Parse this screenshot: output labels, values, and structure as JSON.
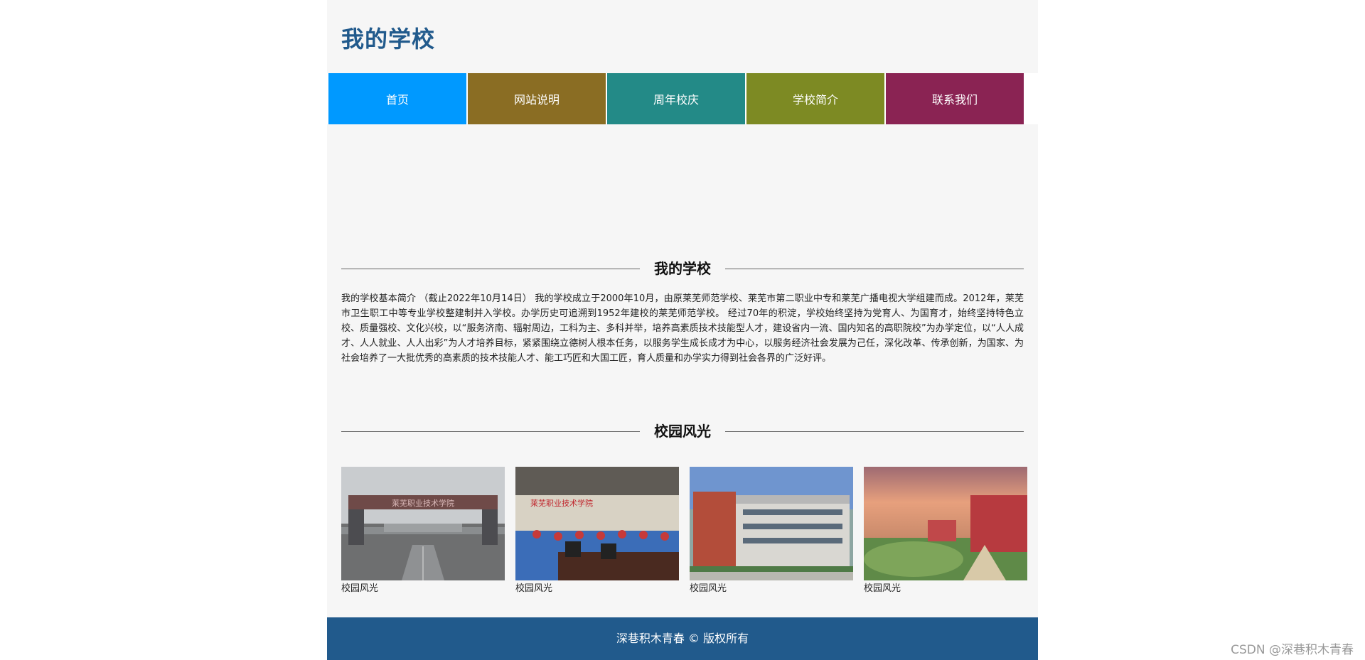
{
  "header": {
    "title": "我的学校"
  },
  "nav": {
    "items": [
      {
        "label": "首页",
        "color": "#0099ff"
      },
      {
        "label": "网站说明",
        "color": "#8a6d23"
      },
      {
        "label": "周年校庆",
        "color": "#238a87"
      },
      {
        "label": "学校简介",
        "color": "#7d8a23"
      },
      {
        "label": "联系我们",
        "color": "#8a2353"
      }
    ]
  },
  "about": {
    "heading": "我的学校",
    "text": "我的学校基本简介 （截止2022年10月14日） 我的学校成立于2000年10月，由原莱芜师范学校、莱芜市第二职业中专和莱芜广播电视大学组建而成。2012年，莱芜市卫生职工中等专业学校整建制并入学校。办学历史可追溯到1952年建校的莱芜师范学校。 经过70年的积淀，学校始终坚持为党育人、为国育才，始终坚持特色立校、质量强校、文化兴校，以“服务济南、辐射周边，工科为主、多科并举，培养高素质技术技能型人才，建设省内一流、国内知名的高职院校”为办学定位，以“人人成才、人人就业、人人出彩”为人才培养目标，紧紧围绕立德树人根本任务，以服务学生成长成才为中心，以服务经济社会发展为己任，深化改革、传承创新，为国家、为社会培养了一大批优秀的高素质的技术技能人才、能工巧匠和大国工匠，育人质量和办学实力得到社会各界的广泛好评。"
  },
  "gallery": {
    "heading": "校园风光",
    "items": [
      {
        "caption": "校园风光",
        "sign": "莱芜职业技术学院"
      },
      {
        "caption": "校园风光",
        "sign": "莱芜职业技术学院"
      },
      {
        "caption": "校园风光"
      },
      {
        "caption": "校园风光"
      }
    ]
  },
  "footer": {
    "text": "深巷积木青春 © 版权所有"
  },
  "watermark": "CSDN @深巷积木青春"
}
